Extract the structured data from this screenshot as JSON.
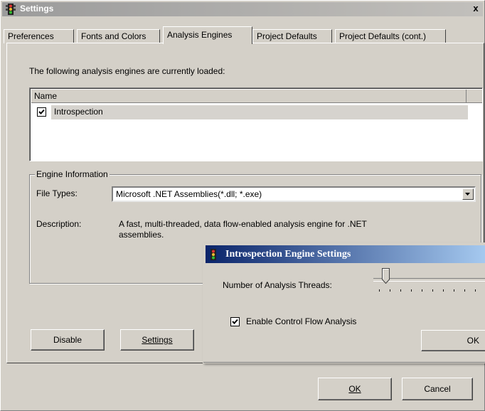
{
  "window": {
    "title": "Settings",
    "close_glyph": "x"
  },
  "tabs": [
    {
      "label": "Preferences"
    },
    {
      "label": "Fonts and Colors"
    },
    {
      "label": "Analysis Engines"
    },
    {
      "label": "Project Defaults"
    },
    {
      "label": "Project Defaults (cont.)"
    }
  ],
  "active_tab": "Analysis Engines",
  "main": {
    "intro_text": "The following analysis engines are currently loaded:",
    "list": {
      "column_header": "Name",
      "items": [
        {
          "label": "Introspection",
          "checked": true
        }
      ]
    },
    "engine_info": {
      "group_title": "Engine Information",
      "file_types_label": "File Types:",
      "file_types_value": "Microsoft .NET Assemblies(*.dll; *.exe)",
      "description_label": "Description:",
      "description_line1": "A fast, multi-threaded, data flow-enabled analysis engine for .NET",
      "description_line2": "assemblies."
    },
    "buttons": {
      "disable": "Disable",
      "settings": "Settings"
    }
  },
  "footer": {
    "ok": "OK",
    "cancel": "Cancel"
  },
  "popup": {
    "title": "Introspection Engine Settings",
    "threads_label": "Number of Analysis Threads:",
    "threads_level": 0.1,
    "control_flow_label": "Enable Control Flow Analysis",
    "control_flow_checked": true,
    "ok": "OK"
  },
  "colors": {
    "window_bg": "#d4d0c8",
    "popup_title_start": "#0a246a",
    "popup_title_end": "#a6caf0",
    "titlebar_inactive": "#9b9b9b"
  },
  "icons": {
    "app": "traffic-light-icon",
    "close": "close-icon",
    "combo_arrow": "chevron-down-icon"
  }
}
